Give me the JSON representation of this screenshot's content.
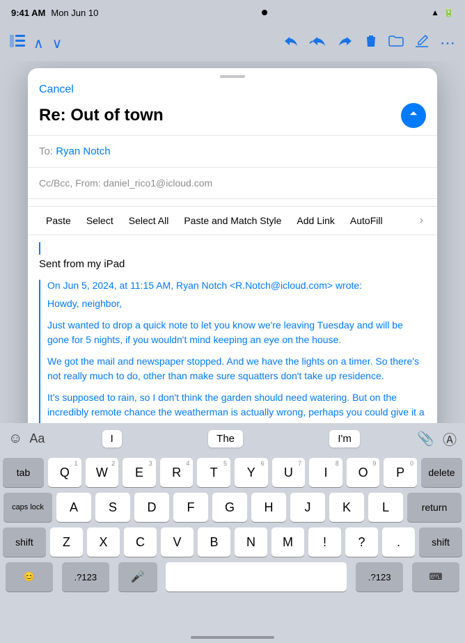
{
  "statusBar": {
    "time": "9:41 AM",
    "date": "Mon Jun 10",
    "wifi": "WiFi",
    "battery": "100%"
  },
  "toolbar": {
    "prevIcon": "chevron-up",
    "nextIcon": "chevron-down",
    "replyIcon": "reply",
    "replyAllIcon": "reply-all",
    "forwardIcon": "forward",
    "trashIcon": "trash",
    "folderIcon": "folder",
    "composeIcon": "compose",
    "moreIcon": "ellipsis"
  },
  "compose": {
    "cancelLabel": "Cancel",
    "subject": "Re: Out of town",
    "toLabel": "To:",
    "toName": "Ryan Notch",
    "ccLine": "Cc/Bcc, From: daniel_rico1@icloud.com"
  },
  "contextMenu": {
    "buttons": [
      "Paste",
      "Select",
      "Select All",
      "Paste and Match Style",
      "Add Link",
      "AutoFill"
    ],
    "moreIcon": "›"
  },
  "emailBody": {
    "signature": "Sent from my iPad",
    "quotedHeader": "On Jun 5, 2024, at 11:15 AM, Ryan Notch <R.Notch@icloud.com> wrote:",
    "paragraphs": [
      "Howdy, neighbor,",
      "Just wanted to drop a quick note to let you know we're leaving Tuesday and will be gone for 5 nights, if you wouldn't mind keeping an eye on the house.",
      "We got the mail and newspaper stopped. And we have the lights on a timer. So there's not really much to do, other than make sure squatters don't take up residence.",
      "It's supposed to rain, so I don't think the garden should need watering. But on the incredibly remote chance the weatherman is actually wrong, perhaps you could give it a quick sprinkling. Thanks. We'll see you when we get back!"
    ]
  },
  "quicktype": {
    "word1": "I",
    "word2": "The",
    "word3": "I'm"
  },
  "keyboard": {
    "row1": [
      {
        "letter": "Q",
        "sub": "1"
      },
      {
        "letter": "W",
        "sub": "2"
      },
      {
        "letter": "E",
        "sub": "3"
      },
      {
        "letter": "R",
        "sub": "4"
      },
      {
        "letter": "T",
        "sub": "5"
      },
      {
        "letter": "Y",
        "sub": "6"
      },
      {
        "letter": "U",
        "sub": "7"
      },
      {
        "letter": "I",
        "sub": "8"
      },
      {
        "letter": "O",
        "sub": "9"
      },
      {
        "letter": "P",
        "sub": "0"
      }
    ],
    "row2": [
      {
        "letter": "A",
        "sub": ""
      },
      {
        "letter": "S",
        "sub": ""
      },
      {
        "letter": "D",
        "sub": ""
      },
      {
        "letter": "F",
        "sub": ""
      },
      {
        "letter": "G",
        "sub": ""
      },
      {
        "letter": "H",
        "sub": ""
      },
      {
        "letter": "J",
        "sub": ""
      },
      {
        "letter": "K",
        "sub": ""
      },
      {
        "letter": "L",
        "sub": ""
      }
    ],
    "row3": [
      {
        "letter": "Z",
        "sub": ""
      },
      {
        "letter": "X",
        "sub": ""
      },
      {
        "letter": "C",
        "sub": ""
      },
      {
        "letter": "V",
        "sub": ""
      },
      {
        "letter": "B",
        "sub": ""
      },
      {
        "letter": "N",
        "sub": ""
      },
      {
        "letter": "M",
        "sub": ""
      },
      {
        "letter": "!",
        "sub": ""
      },
      {
        "letter": "?",
        "sub": ""
      },
      {
        "letter": ".",
        "sub": ""
      }
    ],
    "tabLabel": "tab",
    "capsLabel": "caps lock",
    "returnLabel": "return",
    "shiftLabel": "shift",
    "deleteLabel": "delete",
    "spaceLabel": "",
    "emojiLabel": "😊",
    "numbersLabel": ".?123",
    "micLabel": "🎤",
    "numbersLabel2": ".?123",
    "keyboardLabel": "⌨"
  }
}
